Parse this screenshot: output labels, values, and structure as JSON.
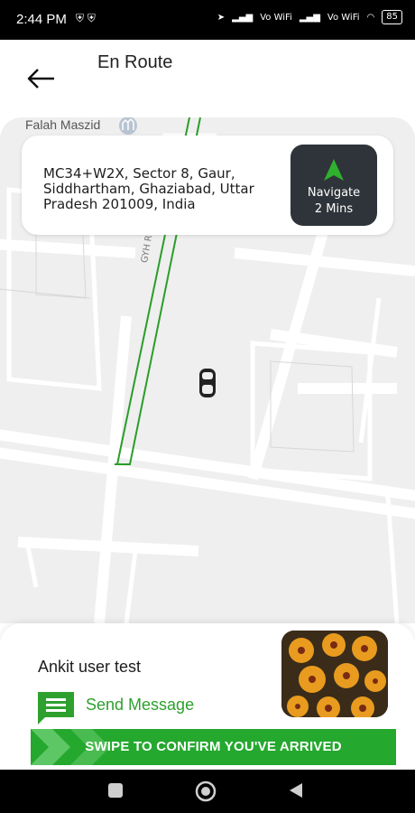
{
  "status": {
    "time": "2:44 PM",
    "network1": "Vo WiFi",
    "network2": "Vo WiFi",
    "battery": "85"
  },
  "header": {
    "title": "En Route"
  },
  "map": {
    "poi": "Falah Maszid",
    "road_label": "GYH Rd"
  },
  "destination": {
    "address": "MC34+W2X, Sector 8, Gaur, Siddhartham, Ghaziabad, Uttar Pradesh 201009, India",
    "navigate_label": "Navigate",
    "eta": "2 Mins"
  },
  "customer": {
    "name": "Ankit user test",
    "message_label": "Send Message"
  },
  "swipe": {
    "label": "SWIPE TO CONFIRM YOU'VE ARRIVED"
  },
  "colors": {
    "accent": "#24a82e",
    "navigate_bg": "#2f343a"
  }
}
